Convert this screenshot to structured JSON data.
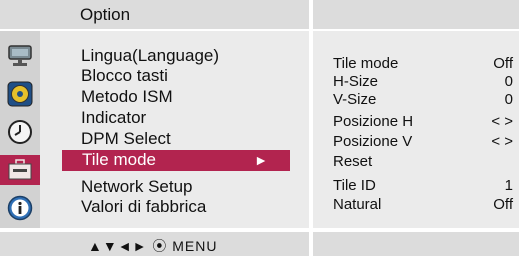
{
  "header": {
    "title": "Option"
  },
  "sidebar": {
    "icons": [
      "monitor-icon",
      "disc-icon",
      "clock-icon",
      "toolbox-icon",
      "info-icon"
    ],
    "selected_icon": "toolbox-icon"
  },
  "menu": {
    "items": [
      "Lingua(Language)",
      "Blocco tasti",
      "Metodo ISM",
      "Indicator",
      "DPM Select",
      "Tile mode",
      "Network Setup",
      "Valori di fabbrica"
    ],
    "selected_index": 5,
    "selected_arrow": "►"
  },
  "submenu": {
    "rows": [
      {
        "label": "Tile mode",
        "value": "Off"
      },
      {
        "label": "H-Size",
        "value": "0"
      },
      {
        "label": "V-Size",
        "value": "0"
      },
      {
        "label": "Posizione H",
        "value": "< >"
      },
      {
        "label": "Posizione V",
        "value": "< >"
      },
      {
        "label": "Reset",
        "value": ""
      },
      {
        "label": "Tile ID",
        "value": "1"
      },
      {
        "label": "Natural",
        "value": "Off"
      }
    ]
  },
  "footer": {
    "keys": "▲▼◄► ⦿ MENU"
  },
  "colors": {
    "highlight": "#b2244f",
    "panel": "#ebebeb",
    "bar": "#dcdcdc"
  }
}
